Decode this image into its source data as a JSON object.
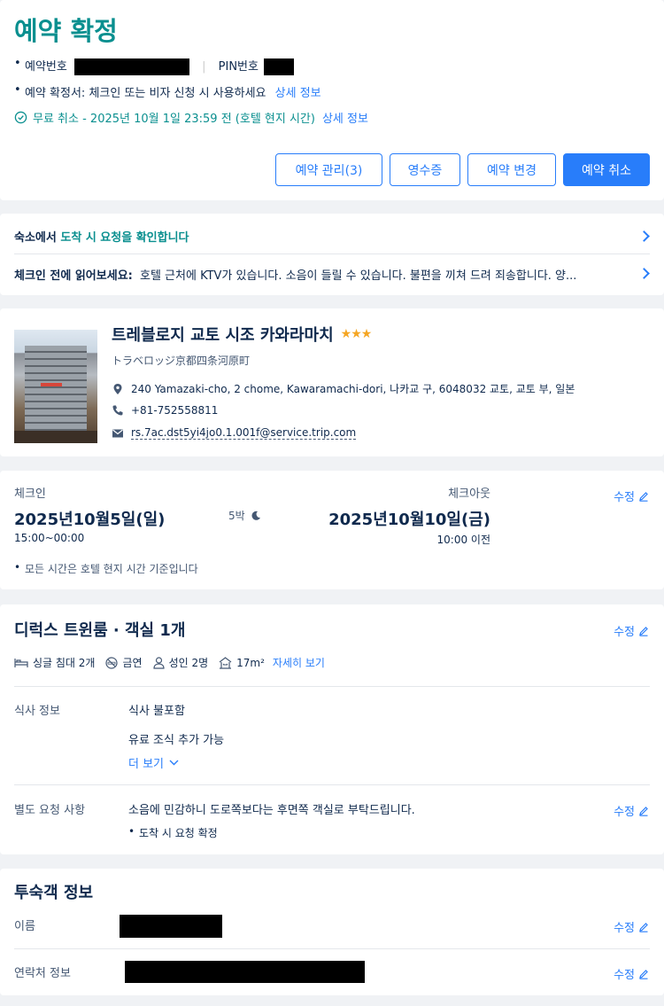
{
  "header": {
    "title": "예약 확정",
    "booking_no_label": "예약번호",
    "pin_label": "PIN번호",
    "confirmation_text": "예약 확정서: 체크인 또는 비자 신청 시 사용하세요",
    "confirmation_link": "상세 정보",
    "free_cancel_text": "무료 취소 - 2025년 10월 1일 23:59 전 (호텔 현지 시간)",
    "free_cancel_link": "상세 정보",
    "buttons": {
      "manage": "예약 관리(3)",
      "receipt": "영수증",
      "change": "예약 변경",
      "cancel": "예약 취소"
    }
  },
  "notices": {
    "arrival_prefix": "숙소에서 ",
    "arrival_highlight": "도착 시 요청을 확인합니다",
    "read_label": "체크인 전에 읽어보세요:",
    "read_text": "호텔 근처에 KTV가 있습니다. 소음이 들릴 수 있습니다. 불편을 끼쳐 드려 죄송합니다. 양..."
  },
  "hotel": {
    "name": "트레블로지 교토 시조 카와라마치",
    "stars": "★★★",
    "local_name": "トラベロッジ京都四条河原町",
    "address": "240 Yamazaki-cho, 2 chome, Kawaramachi-dori, 나카교 구, 6048032 교토, 교토 부, 일본",
    "phone": "+81-752558811",
    "email": "rs.7ac.dst5yi4jo0.1.001f@service.trip.com"
  },
  "stay": {
    "checkin_label": "체크인",
    "checkin_date": "2025년10월5일(일)",
    "checkin_time": "15:00~00:00",
    "nights": "5박",
    "checkout_label": "체크아웃",
    "checkout_date": "2025년10월10일(금)",
    "checkout_time": "10:00 이전",
    "edit": "수정",
    "note": "모든 시간은 호텔 현지 시간 기준입니다"
  },
  "room": {
    "title": "디럭스 트윈룸 · 객실 1개",
    "edit": "수정",
    "bed": "싱글 침대 2개",
    "smoking": "금연",
    "guests": "성인 2명",
    "size": "17m²",
    "details_link": "자세히 보기",
    "meal_label": "식사 정보",
    "meal_value": "식사 불포함",
    "meal_extra": "유료 조식 추가 가능",
    "more_link": "더 보기",
    "request_label": "별도 요청 사항",
    "request_value": "소음에 민감하니 도로쪽보다는 후면쪽 객실로 부탁드립니다.",
    "request_status": "도착 시 요청 확정",
    "request_edit": "수정"
  },
  "guest": {
    "title": "투숙객 정보",
    "name_label": "이름",
    "contact_label": "연락처 정보",
    "edit1": "수정",
    "edit2": "수정"
  },
  "colors": {
    "accent": "#287dfa",
    "teal": "#0a8f8f",
    "text": "#0f294d",
    "star": "#f5a623"
  }
}
